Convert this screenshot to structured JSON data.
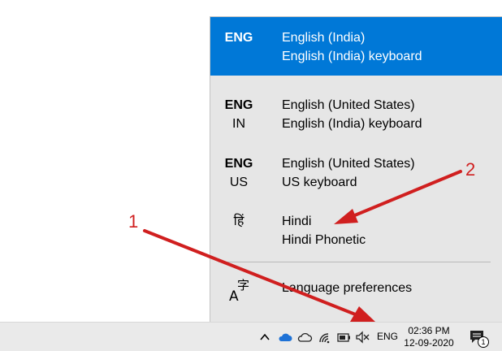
{
  "language_flyout": {
    "items": [
      {
        "code_primary": "ENG",
        "code_secondary": "",
        "language": "English (India)",
        "keyboard": "English (India) keyboard",
        "selected": true
      },
      {
        "code_primary": "ENG",
        "code_secondary": "IN",
        "language": "English (United States)",
        "keyboard": "English (India) keyboard",
        "selected": false
      },
      {
        "code_primary": "ENG",
        "code_secondary": "US",
        "language": "English (United States)",
        "keyboard": "US keyboard",
        "selected": false
      },
      {
        "code_primary": "हिं",
        "code_secondary": "",
        "language": "Hindi",
        "keyboard": "Hindi Phonetic",
        "selected": false
      }
    ],
    "preferences_label": "Language preferences",
    "preferences_icon": "language-settings-icon",
    "selected_color": "#0078d7"
  },
  "taskbar": {
    "tray_icons": [
      "chevron-up-icon",
      "onedrive-cloud-icon",
      "onedrive-cloud-outline-icon",
      "wifi-icon",
      "battery-icon",
      "speaker-muted-icon"
    ],
    "language_indicator": "ENG",
    "time": "02:36 PM",
    "date": "12-09-2020",
    "notification_count": "1"
  },
  "annotations": {
    "label_1": "1",
    "label_2": "2",
    "color": "#d01f1f"
  }
}
